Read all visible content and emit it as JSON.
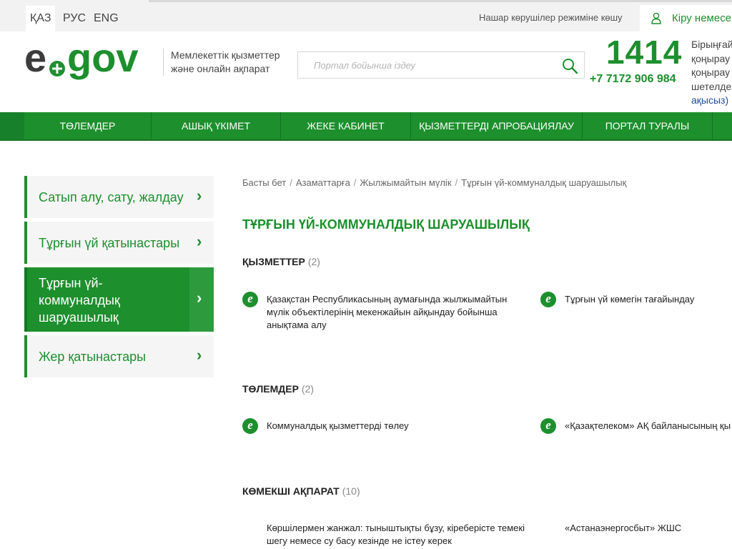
{
  "header": {
    "languages": [
      "ҚАЗ",
      "РУС",
      "ENG"
    ],
    "vision_mode": "Нашар көрушілер режиміне көшу",
    "login": "Кіру немесе",
    "tagline": [
      "Мемлекеттік қызметтер",
      "және онлайн ақпарат"
    ],
    "search_placeholder": "Портал бойынша іздеу",
    "phone_main": "1414",
    "phone_alt": "+7 7172 906 984",
    "phone_note": [
      "Бірыңғай",
      "қоңырау",
      "қоңырау",
      "шетелде",
      "ақысыз)"
    ]
  },
  "nav": [
    "ТӨЛЕМДЕР",
    "АШЫҚ ҮКІМЕТ",
    "ЖЕКЕ КАБИНЕТ",
    "ҚЫЗМЕТТЕРДІ АПРОБАЦИЯЛАУ",
    "ПОРТАЛ ТУРАЛЫ"
  ],
  "sidebar": [
    {
      "label": "Сатып алу, сату, жалдау"
    },
    {
      "label": "Тұрғын үй қатынастары"
    },
    {
      "label": "Тұрғын үй-коммуналдық шаруашылық"
    },
    {
      "label": "Жер қатынастары"
    }
  ],
  "breadcrumbs": [
    "Басты бет",
    "Азаматтарға",
    "Жылжымайтын мүлік",
    "Тұрғын үй-коммуналдық шаруашылық"
  ],
  "page_title": "ТҰРҒЫН ҮЙ-КОММУНАЛДЫҚ ШАРУАШЫЛЫҚ",
  "sections": [
    {
      "title": "ҚЫЗМЕТТЕР",
      "count": "(2)",
      "items": [
        "Қазақстан Республикасының аумағында жылжымайтын мүлік объектілерінің мекенжайын айқындау бойынша анықтама алу",
        "Тұрғын үй көмегін тағайындау"
      ]
    },
    {
      "title": "ТӨЛЕМДЕР",
      "count": "(2)",
      "items": [
        "Коммуналдық қызметтерді төлеу",
        "«Қазақтелеком» АҚ байланысының қы"
      ]
    },
    {
      "title": "КӨМЕКШІ АҚПАРАТ",
      "count": "(10)",
      "items": [
        "Көршілермен жанжал: тыныштықты бұзу, кіреберісте темекі шегу немесе су басу кезінде не істеу керек",
        "«Астанаэнергосбыт» ЖШС"
      ]
    }
  ],
  "service_icon_letter": "e",
  "colors": {
    "brand_green": "#1d8f2d",
    "brand_dark": "#3c3c3c",
    "link_blue": "#1a4fa0"
  }
}
